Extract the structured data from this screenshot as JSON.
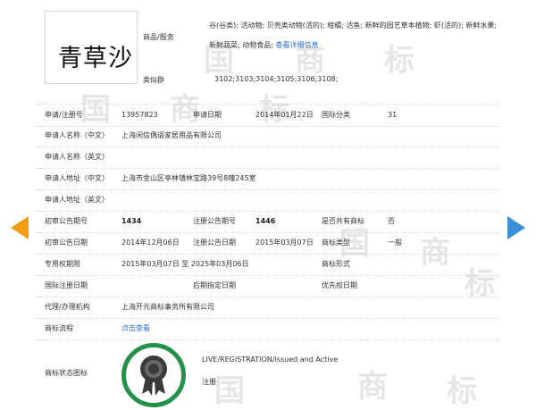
{
  "watermarks": [
    "国",
    "商",
    "标",
    "国",
    "商",
    "标",
    "国",
    "商",
    "标",
    "国",
    "商",
    "标"
  ],
  "logo_text": "青草沙",
  "goods": {
    "label": "商品/服务",
    "text": "谷(谷类); 活动物; 贝壳类动物(活的); 柑橘; 活鱼; 新鲜的园艺草本植物; 虾(活的); 新鲜水果; 新鲜蔬菜; 动物食品; ",
    "link": "查看详细信息"
  },
  "similar": {
    "label": "类似群",
    "value": "3102;3103;3104;3105;3106;3108;"
  },
  "rows": {
    "reg_no_label": "申请/注册号",
    "reg_no": "13957823",
    "apply_date_label": "申请日期",
    "apply_date": "2014年01月22日",
    "intl_class_label": "国际分类",
    "intl_class": "31",
    "applicant_cn_label": "申请人名称（中文）",
    "applicant_cn": "上海闲信偶语家居用品有限公司",
    "applicant_en_label": "申请人名称（英文）",
    "addr_cn_label": "申请人地址（中文）",
    "addr_cn": "上海市金山区亭林镇林宝路39号8幢245室",
    "addr_en_label": "申请人地址（英文）",
    "prelim_no_label": "初审公告期号",
    "prelim_no": "1434",
    "reg_pub_no_label": "注册公告期号",
    "reg_pub_no": "1446",
    "shared_label": "是否共有商标",
    "shared": "否",
    "prelim_date_label": "初审公告日期",
    "prelim_date": "2014年12月06日",
    "reg_pub_date_label": "注册公告日期",
    "reg_pub_date": "2015年03月07日",
    "tm_type_label": "商标类型",
    "tm_type": "一般",
    "exclusive_label": "专用权期限",
    "exclusive": "2015年03月07日 至 2025年03月06日",
    "tm_form_label": "商标形式",
    "intl_reg_date_label": "国际注册日期",
    "later_date_label": "后期指定日期",
    "priority_date_label": "优先权日期",
    "agent_label": "代理/办理机构",
    "agent": "上海开元商标事务所有限公司",
    "flow_label": "商标流程",
    "flow_link": "点击查看",
    "status_label": "商标状态图标"
  },
  "status": {
    "en": "LIVE/REGISTRATION/Issued and Active",
    "cn": "注册"
  },
  "colors": {
    "accent_orange": "#f39c12",
    "accent_blue": "#3b8fd6",
    "status_green": "#23914a",
    "link": "#2a6fc9"
  },
  "icons": {
    "left": "arrow-left-icon",
    "right": "arrow-right-icon",
    "status": "award-ribbon-icon"
  }
}
